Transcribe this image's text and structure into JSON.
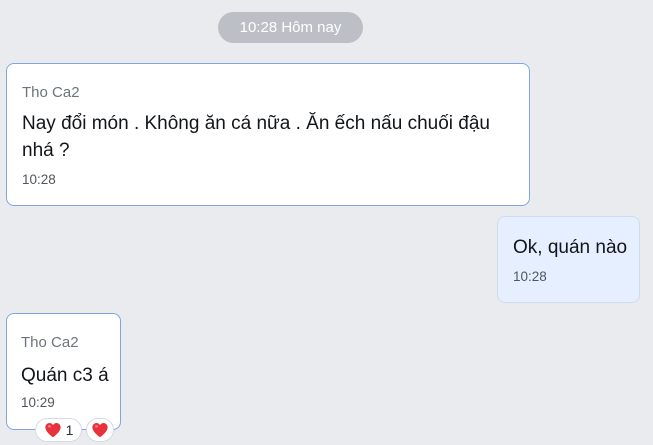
{
  "conversation": {
    "date_pill": "10:28 Hôm nay",
    "messages": [
      {
        "direction": "incoming",
        "sender": "Tho Ca2",
        "text": "Nay đổi món . Không ăn cá nữa . Ăn ếch nấu chuối đậu nhá ?",
        "time": "10:28"
      },
      {
        "direction": "outgoing",
        "text": "Ok, quán nào",
        "time": "10:28"
      },
      {
        "direction": "incoming",
        "sender": "Tho Ca2",
        "text": "Quán c3 á",
        "time": "10:29",
        "reactions": {
          "icon": "heart-icon",
          "count": "1",
          "add_reaction_icon": "heart-icon"
        }
      }
    ]
  },
  "colors": {
    "background": "#e9ebef",
    "incoming_bubble": "#ffffff",
    "incoming_border": "#7ea7dd",
    "outgoing_bubble": "#e5efff",
    "time_pill": "#bcc0c6",
    "heart": "#e8313a"
  }
}
